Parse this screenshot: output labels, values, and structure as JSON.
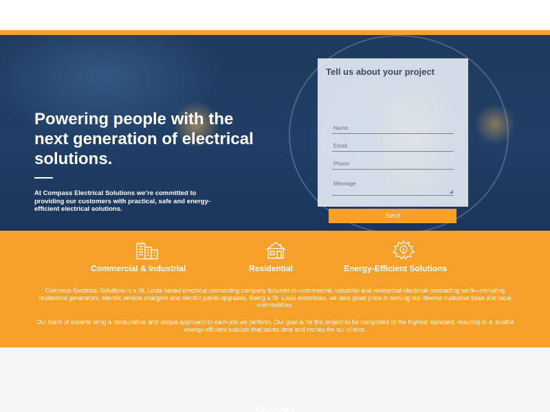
{
  "hero": {
    "title": "Powering people with the next generation of electrical solutions.",
    "subtitle": "At Compass Electrical Solutions we’re committed to providing our customers with practical, safe and energy-efficient electrical solutions."
  },
  "form": {
    "title": "Tell us about your project",
    "name_placeholder": "Name",
    "email_placeholder": "Email",
    "phone_placeholder": "Phone",
    "message_placeholder": "Message",
    "send_label": "Send"
  },
  "services": [
    {
      "label": "Commercial & Industrial",
      "icon": "building-icon"
    },
    {
      "label": "Residential",
      "icon": "house-icon"
    },
    {
      "label": "Energy-Efficient Solutions",
      "icon": "bulb-gear-icon"
    }
  ],
  "about": {
    "paragraph1": "Compass Electrical Solutions is a St. Louis based electrical contracting company focused on commercial, industrial and residential electrical contracting work—including residential generators, electric vehicle chargers and electric panel upgrades. Being a St. Louis electrician, we take great pride in serving our diverse customer base and local communities.",
    "paragraph2": "Our team of experts bring a consultative and unique approach to each job we perform. Our goal is for the project to be completed to the highest standard, resulting in a reliable energy-efficient solution that saves time and money for our clients."
  },
  "services_heading": "Services",
  "colors": {
    "accent": "#f7a12b",
    "hero_bg": "#1e3a5e",
    "form_bg": "#e1e8f0"
  }
}
